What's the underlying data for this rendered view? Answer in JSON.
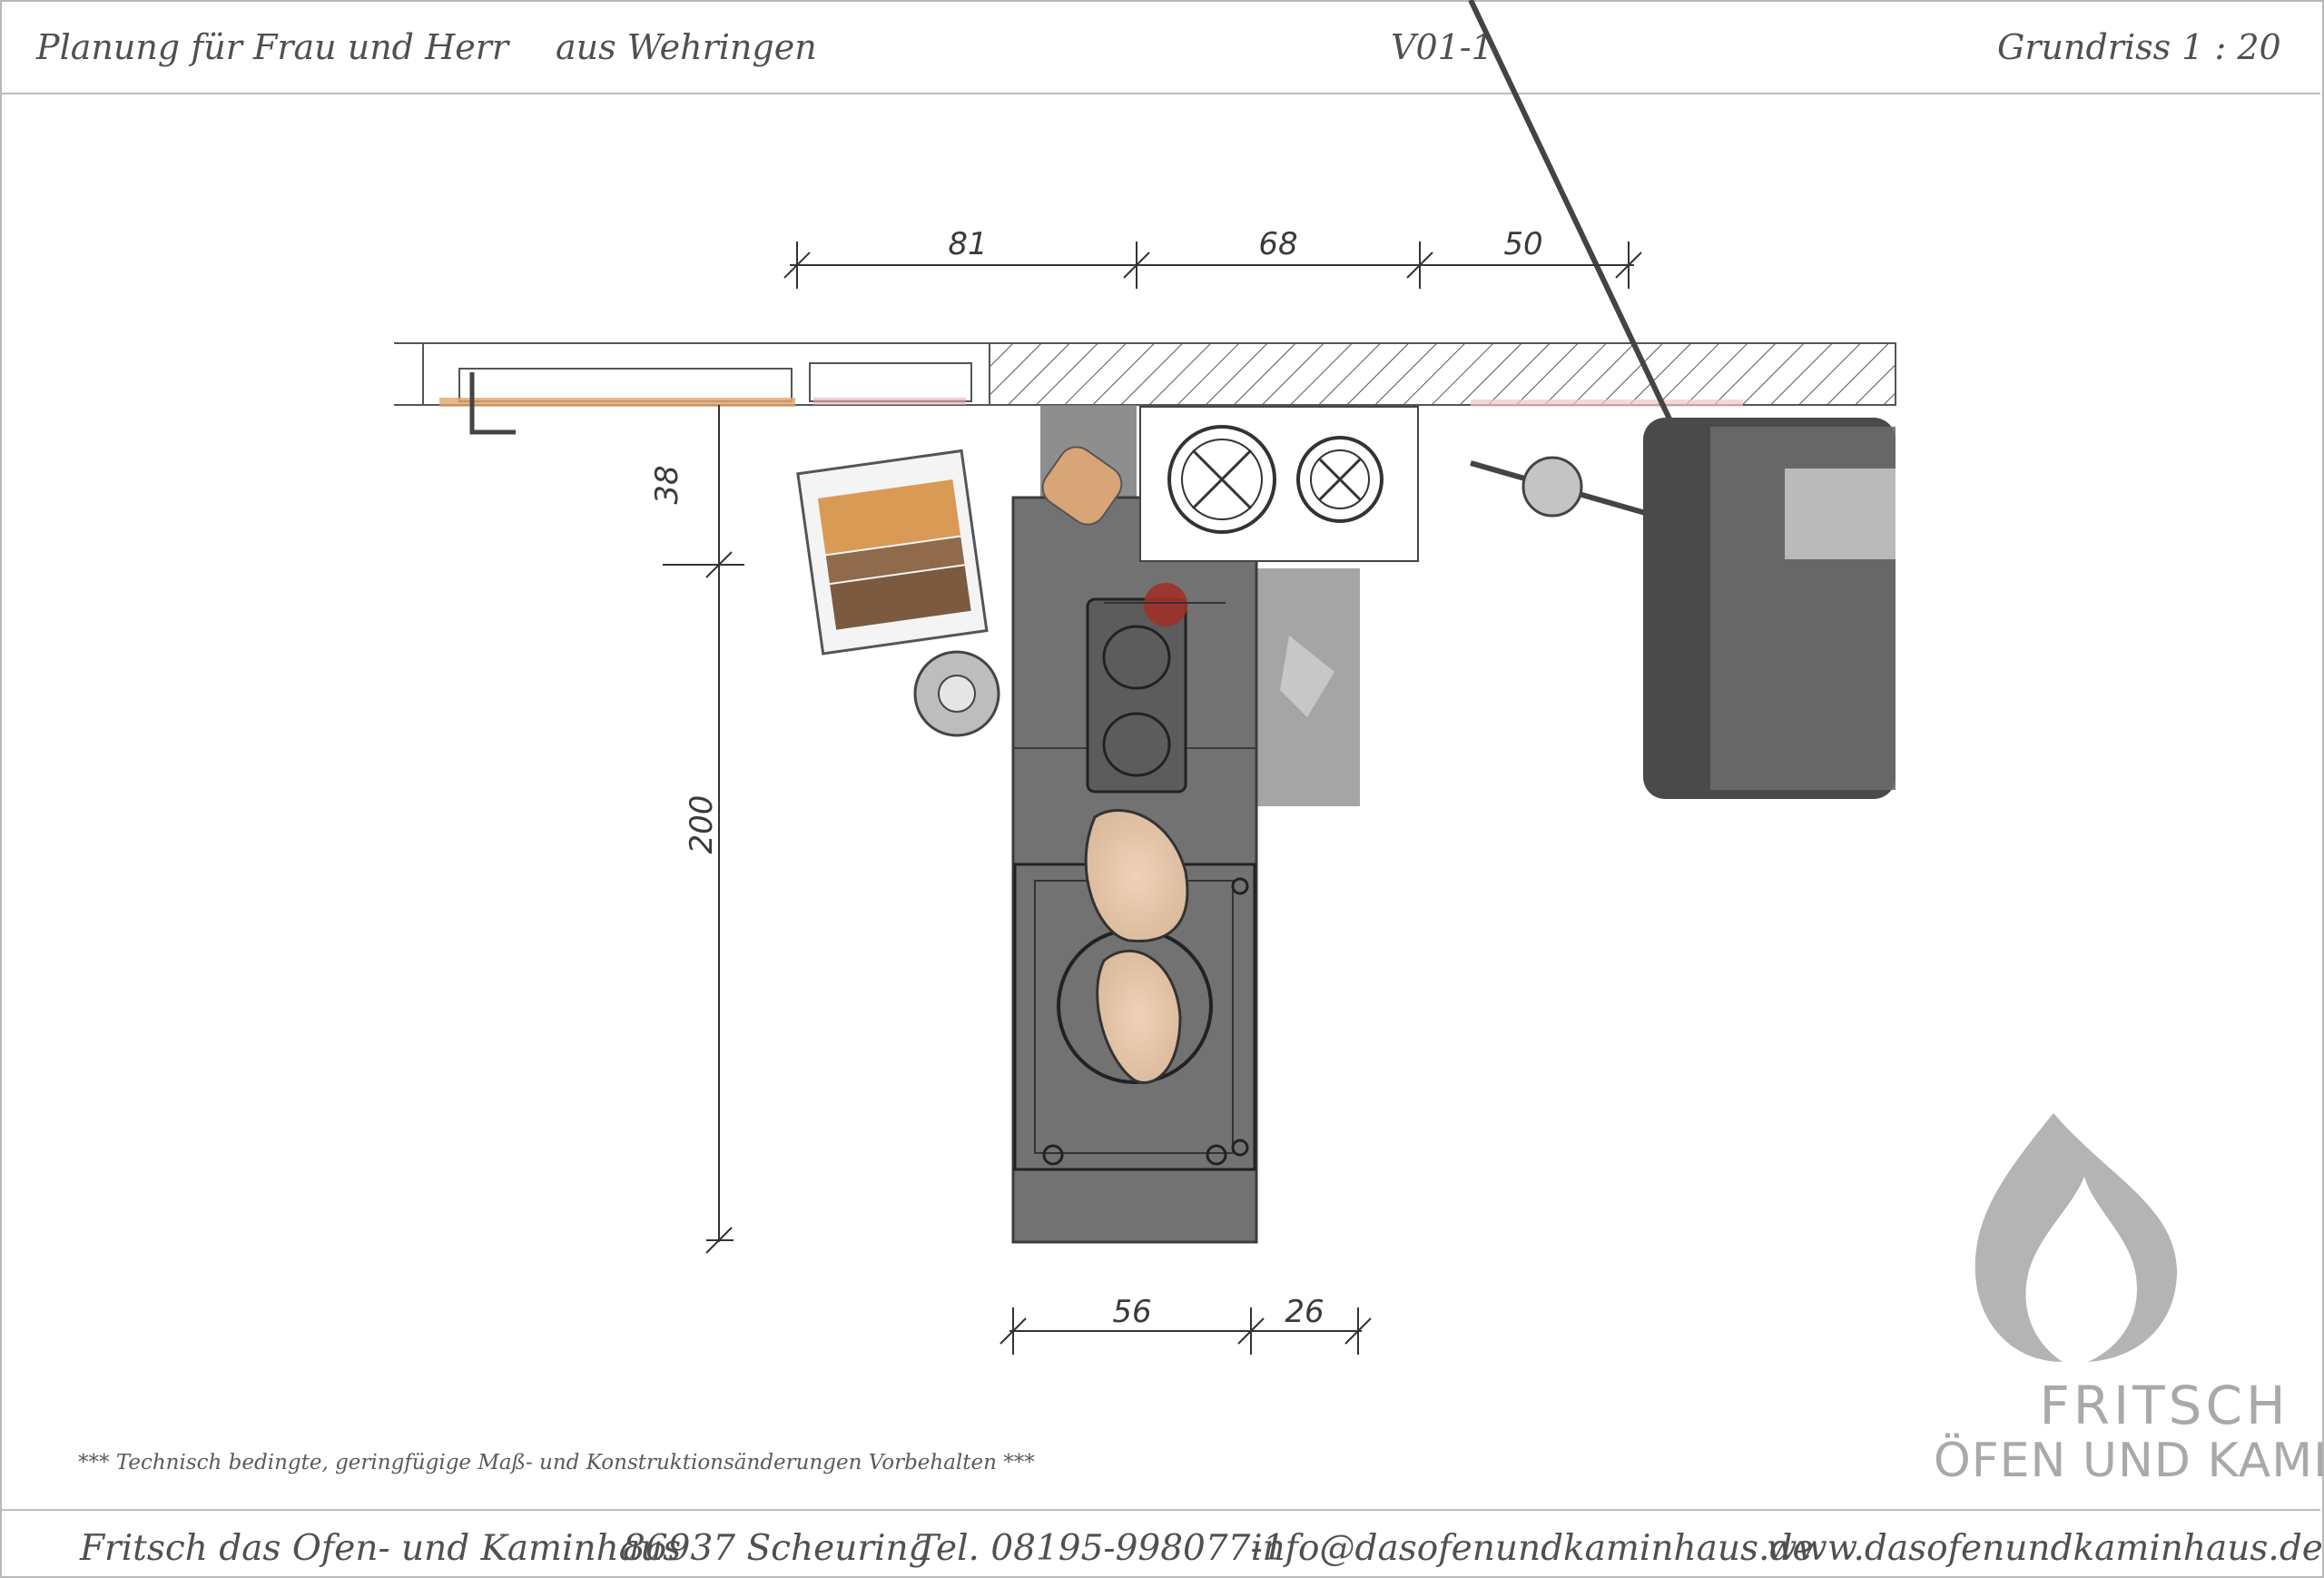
{
  "header": {
    "client": "Planung für Frau und Herr",
    "location": "aus Wehringen",
    "version": "V01-1",
    "plan_scale": "Grundriss 1 : 20"
  },
  "dimensions": {
    "top": [
      "81",
      "68",
      "50"
    ],
    "bottom": [
      "56",
      "26"
    ],
    "left_vertical": [
      "38",
      "200"
    ]
  },
  "note": "***   Technisch bedingte, geringfügige Maß- und Konstruktionsänderungen Vorbehalten   ***",
  "logo": {
    "line1": "FRITSCH",
    "line2": "ÖFEN UND KAMINE"
  },
  "footer": {
    "company": "Fritsch das Ofen- und Kaminhaus",
    "city": "86937 Scheuring",
    "phone": "Tel. 08195-998077-1",
    "email": "info@dasofenundkaminhaus.de",
    "web": "www.dasofenundkaminhaus.de"
  },
  "colors": {
    "stove_body": "#6f6f6f",
    "wood": "#c98a4a",
    "floor_patch": "#8a8a8a",
    "logo": "#b4b4b4"
  }
}
